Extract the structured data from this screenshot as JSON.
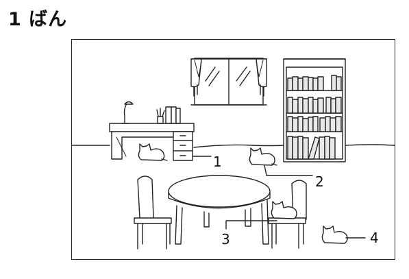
{
  "question": {
    "title": "1 ばん"
  },
  "scene": {
    "labels": [
      "1",
      "2",
      "3",
      "4"
    ]
  }
}
